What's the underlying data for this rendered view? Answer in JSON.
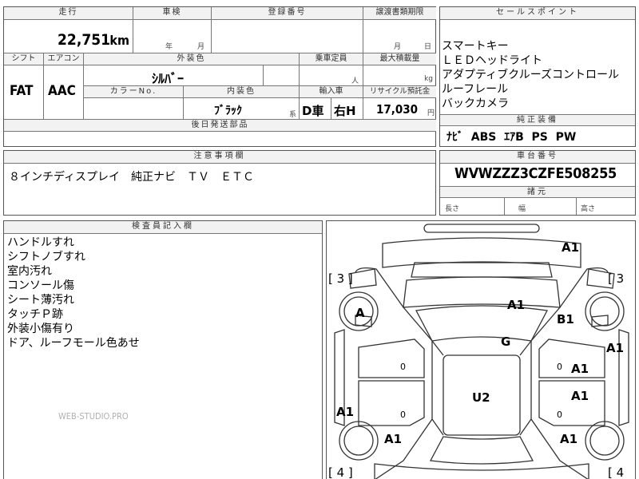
{
  "top": {
    "mileage_label": "走行",
    "mileage_value": "22,751",
    "mileage_unit": "km",
    "inspection_label": "車検",
    "year_unit": "年",
    "month_unit": "月",
    "registration_label": "登録番号",
    "transfer_label": "譲渡書類期限",
    "transfer_month_unit": "月",
    "transfer_day_unit": "日"
  },
  "row2": {
    "shift_label": "シフト",
    "shift_value": "FAT",
    "aircon_label": "エアコン",
    "aircon_value": "AAC",
    "exterior_color_label": "外装色",
    "exterior_color_value": "ｼﾙﾊﾞｰ",
    "capacity_label": "乗車定員",
    "capacity_unit": "人",
    "max_load_label": "最大積載量",
    "max_load_unit": "kg",
    "color_no_label": "カラーNo.",
    "interior_color_label": "内装色",
    "interior_color_value": "ﾌﾞﾗｯｸ",
    "interior_color_suffix": "系",
    "import_label": "輸入車",
    "import_value_1": "D車",
    "import_value_2": "右H",
    "recycle_label": "リサイクル預託金",
    "recycle_value": "17,030",
    "recycle_unit": "円",
    "post_delivery_label": "後日発送部品"
  },
  "sales": {
    "header": "セールスポイント",
    "items": [
      "スマートキー",
      "ＬＥＤヘッドライト",
      "アダプティブクルーズコントロール",
      "ルーフレール",
      "バックカメラ"
    ],
    "genuine_header": "純正装備",
    "genuine_value": "ﾅﾋﾞ  ABS  ｴｱB  PS  PW"
  },
  "notes": {
    "header": "注意事項欄",
    "value": "８インチディスプレイ　純正ナビ　ＴＶ　ＥＴＣ"
  },
  "chassis": {
    "header": "車台番号",
    "value": "WVWZZZ3CZFE508255",
    "dims_header": "諸元",
    "length_label": "長さ",
    "width_label": "幅",
    "height_label": "高さ"
  },
  "inspector": {
    "header": "検査員記入欄",
    "lines": [
      "ハンドルすれ",
      "シフトノブすれ",
      "室内汚れ",
      "コンソール傷",
      "シート薄汚れ",
      "タッチＰ跡",
      "外装小傷有り",
      "ドア、ルーフモール色あせ"
    ],
    "watermark": "WEB-STUDIO.PRO"
  },
  "diagram": {
    "labels": {
      "a1_top": "A1",
      "bracket_tl": "[ 3 ]",
      "bracket_tr": "[ 3",
      "a_left": "A",
      "a1_center": "A1",
      "b1": "B1",
      "a1_right_1": "A1",
      "g": "G",
      "a1_right_2": "A1",
      "u2": "U2",
      "a1_right_3": "A1",
      "a1_left_low": "A1",
      "a1_left_wheel": "A1",
      "a1_right_wheel": "A1",
      "bracket_bl": "[ 4 ]",
      "bracket_br": "[ 4",
      "zero_l1": "0",
      "zero_r1": "0",
      "zero_l2": "0",
      "zero_r2": "0"
    }
  }
}
